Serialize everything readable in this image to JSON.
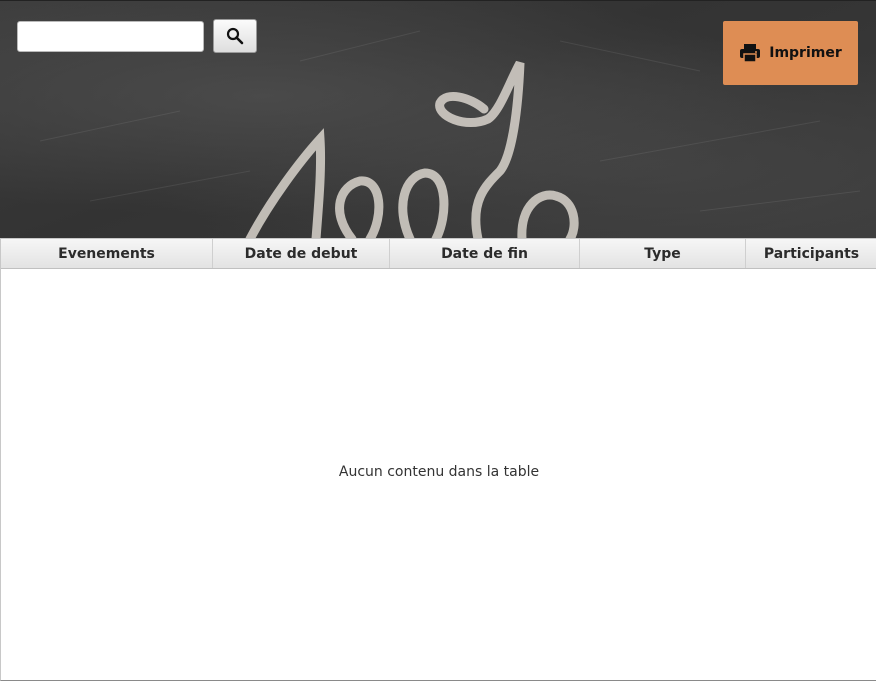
{
  "toolbar": {
    "search_value": "",
    "search_icon": "magnifier-icon",
    "print_label": "Imprimer",
    "print_icon": "printer-icon",
    "print_color": "#de8d54"
  },
  "table": {
    "columns": [
      "Evenements",
      "Date de debut",
      "Date de fin",
      "Type",
      "Participants"
    ],
    "rows": [],
    "empty_message": "Aucun contenu dans la table"
  }
}
